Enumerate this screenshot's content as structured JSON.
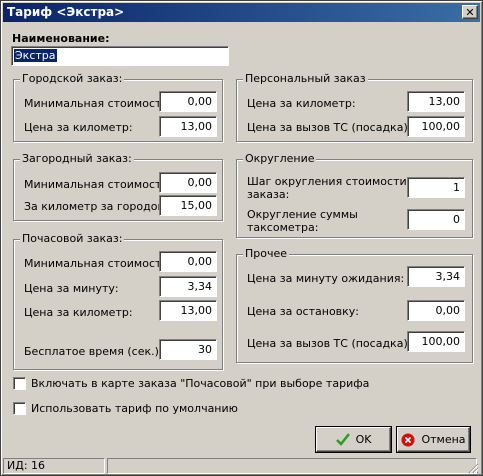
{
  "window": {
    "title": "Тариф <Экстра>",
    "close_glyph": "✕"
  },
  "name": {
    "label": "Наименование:",
    "value": "Экстра"
  },
  "city": {
    "title": "Городской заказ:",
    "min_cost_label": "Минимальная стоимость:",
    "min_cost_value": "0,00",
    "per_km_label": "Цена за километр:",
    "per_km_value": "13,00"
  },
  "suburban": {
    "title": "Загородный заказ:",
    "min_cost_label": "Минимальная стоимость:",
    "min_cost_value": "0,00",
    "per_km_label": "За километр за городом:",
    "per_km_value": "15,00"
  },
  "hourly": {
    "title": "Почасовой заказ:",
    "min_cost_label": "Минимальная стоимость:",
    "min_cost_value": "0,00",
    "per_min_label": "Цена за минуту:",
    "per_min_value": "3,34",
    "per_km_label": "Цена за километр:",
    "per_km_value": "13,00",
    "free_time_label": "Бесплатое время (сек.):",
    "free_time_value": "30"
  },
  "personal": {
    "title": "Персональный заказ",
    "per_km_label": "Цена за километр:",
    "per_km_value": "13,00",
    "call_label": "Цена за вызов ТС (посадка):",
    "call_value": "100,00"
  },
  "rounding": {
    "title": "Округление",
    "step_label_1": "Шаг округления стоимости",
    "step_label_2": "заказа:",
    "step_value": "1",
    "meter_label_1": "Округление суммы",
    "meter_label_2": "таксометра:",
    "meter_value": "0"
  },
  "other": {
    "title": "Прочее",
    "wait_label": "Цена за минуту ожидания:",
    "wait_value": "3,34",
    "stop_label": "Цена за остановку:",
    "stop_value": "0,00",
    "call_label": "Цена за вызов ТС (посадка):",
    "call_value": "100,00"
  },
  "options": {
    "include_hourly_label": "Включать в карте заказа \"Почасовой\" при выборе тарифа",
    "include_hourly_checked": false,
    "default_label": "Использовать тариф по умолчанию",
    "default_checked": false
  },
  "buttons": {
    "ok_label": "OK",
    "cancel_label": "Отмена"
  },
  "status": {
    "id_text": "ИД: 16"
  },
  "colors": {
    "title_start": "#0a246a",
    "title_end": "#3a6ea5",
    "ok_check": "#2a9a2a",
    "cancel_red": "#d01010"
  }
}
